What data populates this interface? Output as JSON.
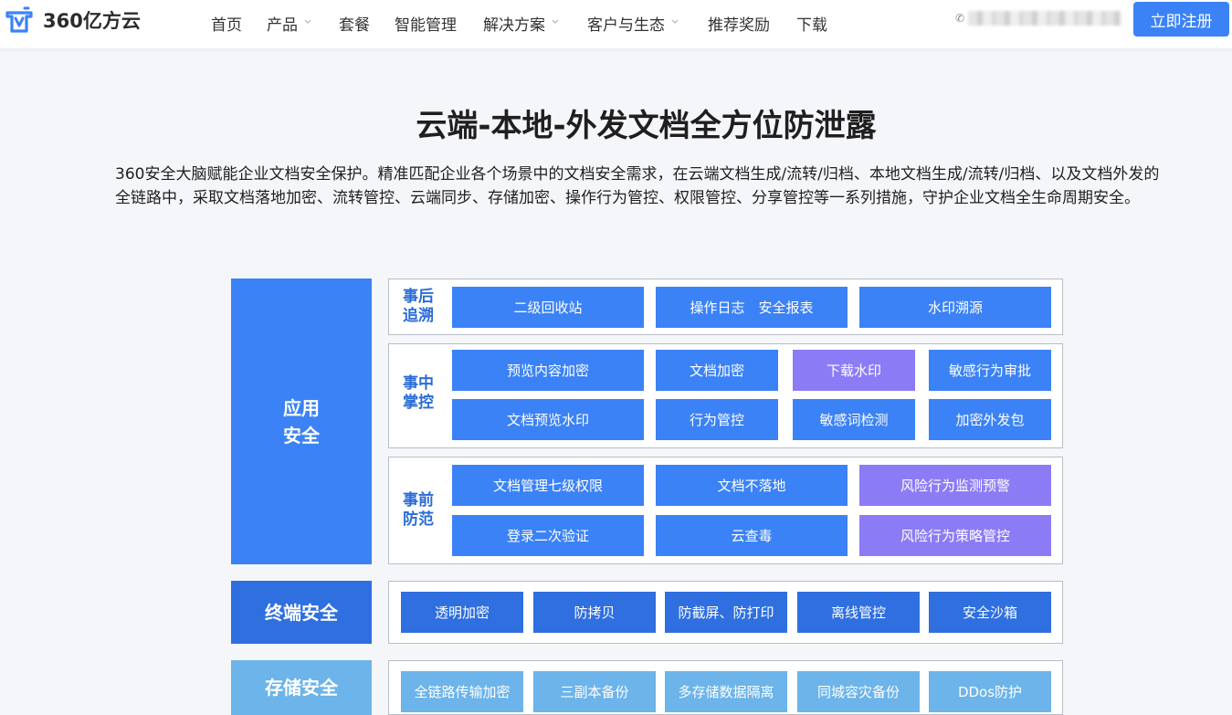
{
  "header": {
    "logo_text": "360亿方云",
    "nav": [
      {
        "label": "首页",
        "dropdown": false
      },
      {
        "label": "产品",
        "dropdown": true
      },
      {
        "label": "套餐",
        "dropdown": false
      },
      {
        "label": "智能管理",
        "dropdown": false
      },
      {
        "label": "解决方案",
        "dropdown": true
      },
      {
        "label": "客户与生态",
        "dropdown": true
      },
      {
        "label": "推荐奖励",
        "dropdown": false
      },
      {
        "label": "下载",
        "dropdown": false
      }
    ],
    "register_label": "立即注册"
  },
  "hero": {
    "title": "云端-本地-外发文档全方位防泄露",
    "description": "360安全大脑赋能企业文档安全保护。精准匹配企业各个场景中的文档安全需求，在云端文档生成/流转/归档、本地文档生成/流转/归档、以及文档外发的全链路中，采取文档落地加密、流转管控、云端同步、存储加密、操作行为管控、权限管控、分享管控等一系列措施，守护企业文档全生命周期安全。"
  },
  "diagram": {
    "app_security": "应用安全",
    "terminal_security": "终端安全",
    "storage_security": "存储安全",
    "after_label": "事后追溯",
    "during_label": "事中掌控",
    "before_label": "事前防范",
    "after_items": [
      "二级回收站",
      "操作日志　安全报表",
      "水印溯源"
    ],
    "during_items": [
      "预览内容加密",
      "文档加密",
      "下载水印",
      "敏感行为审批",
      "文档预览水印",
      "行为管控",
      "敏感词检测",
      "加密外发包"
    ],
    "before_items": [
      "文档管理七级权限",
      "文档不落地",
      "风险行为监测预警",
      "登录二次验证",
      "云查毒",
      "风险行为策略管控"
    ],
    "terminal_items": [
      "透明加密",
      "防拷贝",
      "防截屏、防打印",
      "离线管控",
      "安全沙箱"
    ],
    "storage_items": [
      "全链路传输加密",
      "三副本备份",
      "多存储数据隔离",
      "同城容灾备份",
      "DDos防护"
    ],
    "colors": {
      "blue": "#3b82f6",
      "purple": "#8b7cf6",
      "dark_blue": "#2f6fe0",
      "light_blue": "#6cb4ea",
      "register": "#3b82f6"
    }
  }
}
